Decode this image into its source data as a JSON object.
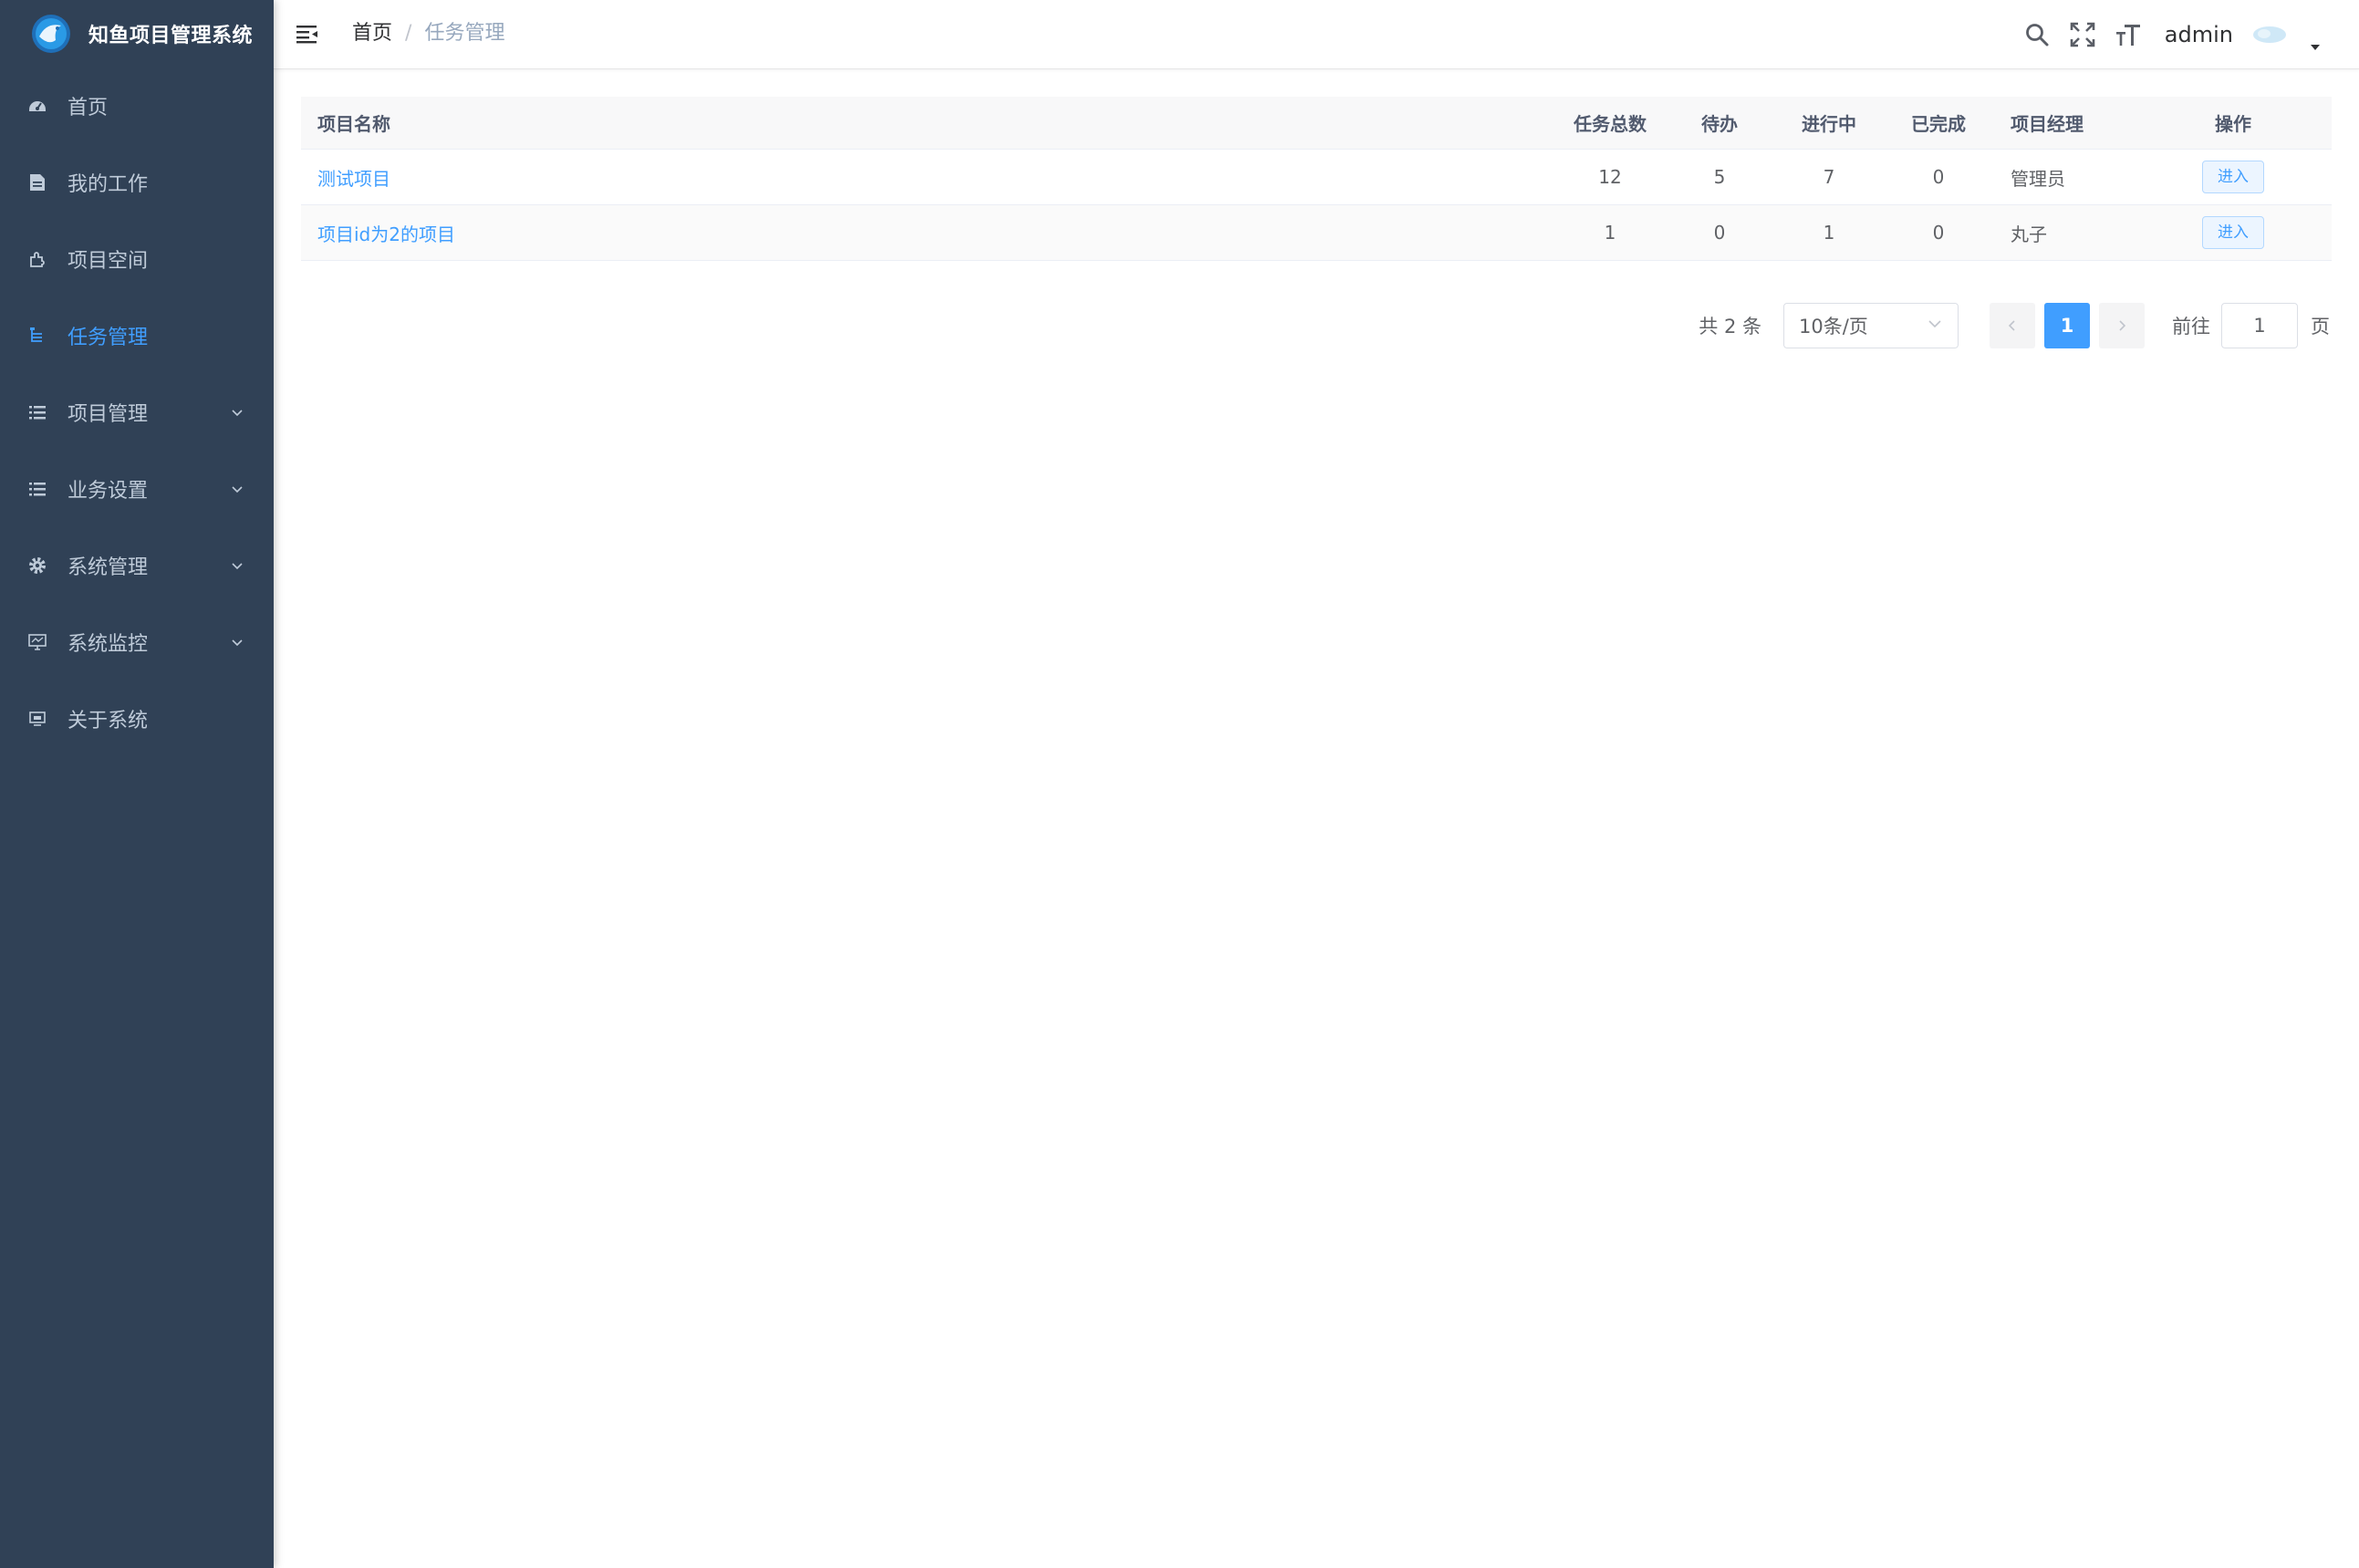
{
  "app": {
    "title": "知鱼项目管理系统",
    "accent": "#409eff",
    "sidebar_bg": "#304156"
  },
  "sidebar": {
    "items": [
      {
        "label": "首页",
        "icon": "dashboard-icon"
      },
      {
        "label": "我的工作",
        "icon": "document-icon"
      },
      {
        "label": "项目空间",
        "icon": "puzzle-icon"
      },
      {
        "label": "任务管理",
        "icon": "tree-icon",
        "active": true
      },
      {
        "label": "项目管理",
        "icon": "list-icon",
        "expandable": true
      },
      {
        "label": "业务设置",
        "icon": "list-icon",
        "expandable": true
      },
      {
        "label": "系统管理",
        "icon": "gear-icon",
        "expandable": true
      },
      {
        "label": "系统监控",
        "icon": "monitor-icon",
        "expandable": true
      },
      {
        "label": "关于系统",
        "icon": "monitor-small-icon"
      }
    ]
  },
  "header": {
    "breadcrumb": {
      "home": "首页",
      "separator": "/",
      "current": "任务管理"
    },
    "username": "admin"
  },
  "table": {
    "headers": {
      "name": "项目名称",
      "total": "任务总数",
      "todo": "待办",
      "doing": "进行中",
      "done": "已完成",
      "manager": "项目经理",
      "op": "操作"
    },
    "rows": [
      {
        "name": "测试项目",
        "total": "12",
        "todo": "5",
        "doing": "7",
        "done": "0",
        "manager": "管理员",
        "op": "进入"
      },
      {
        "name": "项目id为2的项目",
        "total": "1",
        "todo": "0",
        "doing": "1",
        "done": "0",
        "manager": "丸子",
        "op": "进入"
      }
    ]
  },
  "pagination": {
    "total_text": "共 2 条",
    "page_size": "10条/页",
    "current_page": "1",
    "goto_label": "前往",
    "goto_value": "1",
    "page_suffix": "页"
  }
}
